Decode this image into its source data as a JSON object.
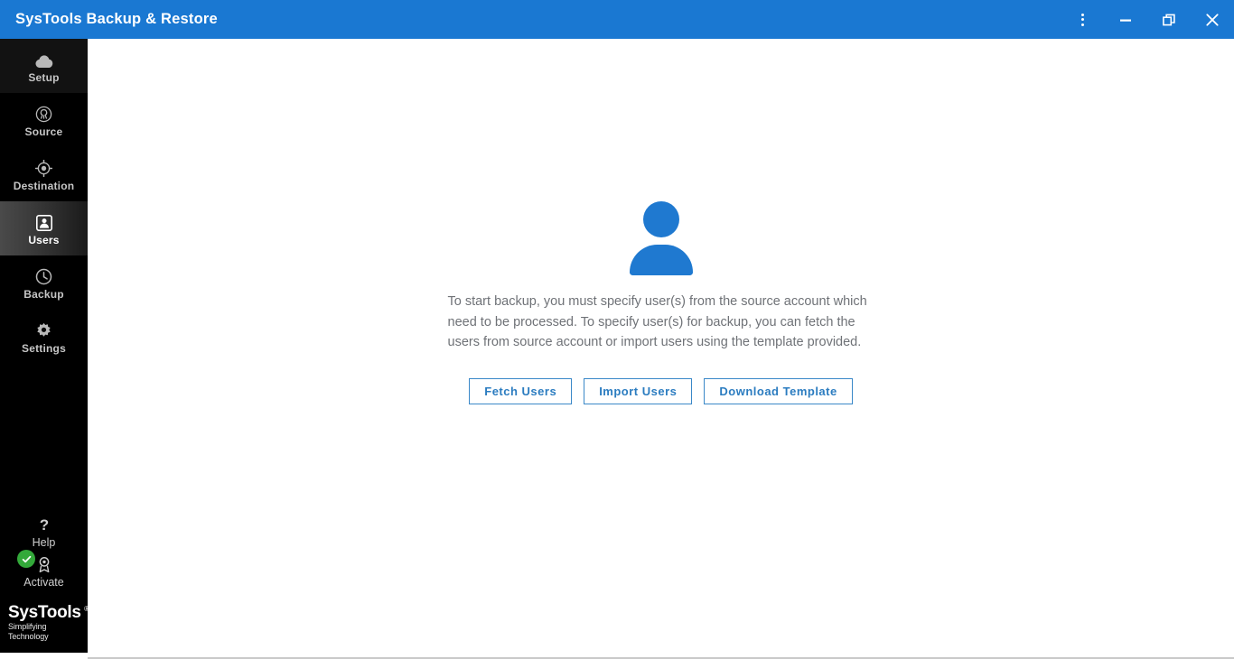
{
  "window": {
    "title": "SysTools Backup & Restore",
    "accent_color": "#1a78d2",
    "controls": [
      {
        "name": "more-options",
        "label": "More options"
      },
      {
        "name": "minimize",
        "label": "Minimize"
      },
      {
        "name": "restore",
        "label": "Restore"
      },
      {
        "name": "close",
        "label": "Close"
      }
    ]
  },
  "sidebar": {
    "background_color": "#000000",
    "active_item": "Users",
    "items": [
      {
        "label": "Setup",
        "icon": "cloud-icon"
      },
      {
        "label": "Source",
        "icon": "source-antenna-icon"
      },
      {
        "label": "Destination",
        "icon": "target-icon"
      },
      {
        "label": "Users",
        "icon": "user-badge-icon"
      },
      {
        "label": "Backup",
        "icon": "clock-icon"
      },
      {
        "label": "Settings",
        "icon": "gear-icon"
      }
    ],
    "bottom_items": [
      {
        "label": "Help",
        "icon": "question-mark-icon"
      },
      {
        "label": "Activate",
        "icon": "award-icon",
        "badge": "check",
        "badge_color": "#33a93a"
      }
    ],
    "logo": {
      "brand": "SysTools",
      "registered": "®",
      "tagline": "Simplifying Technology"
    }
  },
  "main": {
    "illustration": "user-avatar-icon",
    "illustration_color": "#1f79d0",
    "description": "To start backup, you must specify user(s) from the source account which need to be processed. To specify user(s) for backup, you can fetch the users from source account or import users using the template provided.",
    "buttons": [
      {
        "label": "Fetch Users"
      },
      {
        "label": "Import Users"
      },
      {
        "label": "Download Template"
      }
    ],
    "button_color": "#2b7cc0"
  }
}
